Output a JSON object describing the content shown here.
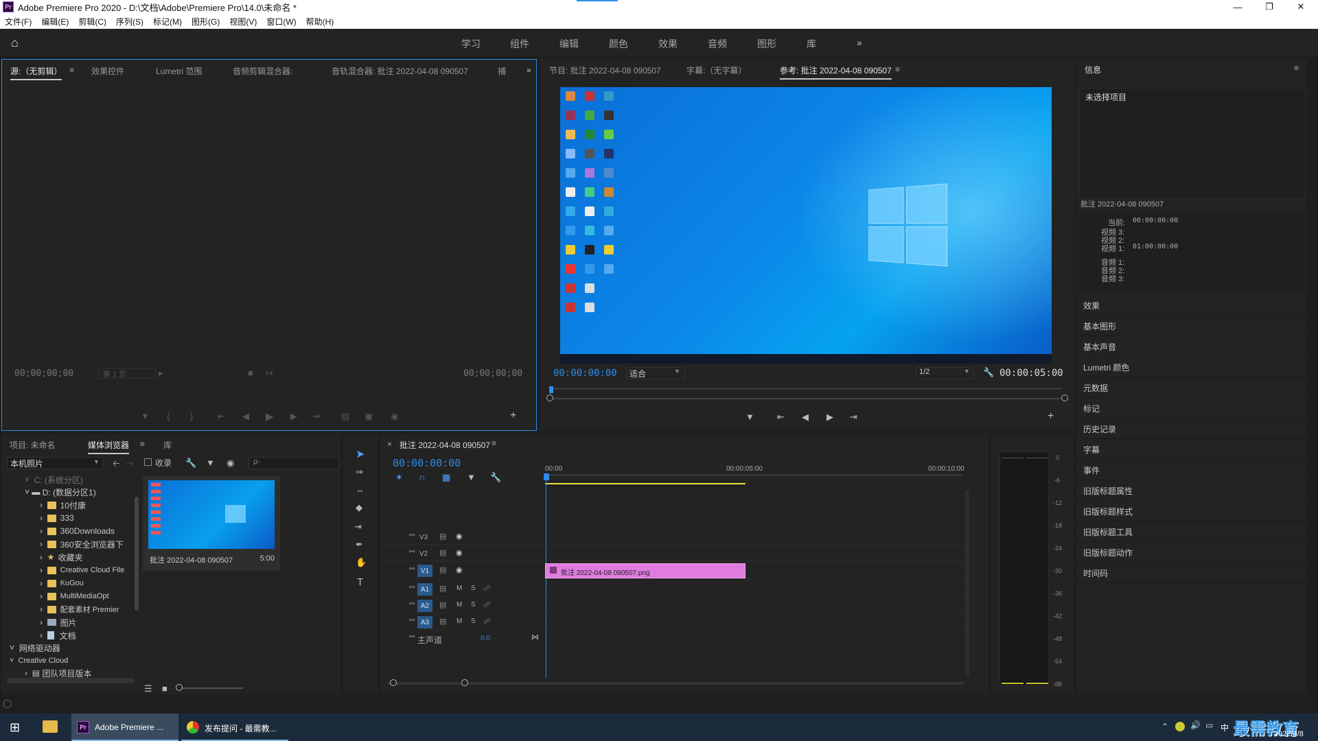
{
  "window": {
    "title": "Adobe Premiere Pro 2020 - D:\\文档\\Adobe\\Premiere Pro\\14.0\\未命名 *",
    "app_icon": "Pr"
  },
  "menu": [
    "文件(F)",
    "编辑(E)",
    "剪辑(C)",
    "序列(S)",
    "标记(M)",
    "图形(G)",
    "视图(V)",
    "窗口(W)",
    "帮助(H)"
  ],
  "workspaces": [
    "学习",
    "组件",
    "编辑",
    "颜色",
    "效果",
    "音频",
    "图形",
    "库"
  ],
  "source_panel": {
    "tabs": [
      "源:（无剪辑）",
      "效果控件",
      "Lumetri 范围",
      "音频剪辑混合器:",
      "音轨混合器: 批注 2022-04-08 090507",
      "捕"
    ],
    "tc_left": "00;00;00;00",
    "tc_right": "00;00;00;00",
    "page": "第 1 页"
  },
  "program_panel": {
    "tabs": [
      "节目: 批注 2022-04-08 090507",
      "字幕:（无字幕）",
      "参考: 批注 2022-04-08 090507"
    ],
    "tc_left": "00:00:00:00",
    "fit": "适合",
    "resolution": "1/2",
    "tc_right": "00:00:05:00"
  },
  "info_panel": {
    "title": "信息",
    "no_selection": "未选择项目",
    "clip_name": "批注 2022-04-08 090507",
    "current_label": "当前:",
    "current_value": "00:00:00:00",
    "video3": "视频 3:",
    "video2": "视频 2:",
    "video1": "视频 1:",
    "video1_value": "01:00:00:00",
    "audio1": "音频 1:",
    "audio2": "音频 2:",
    "audio3": "音频 3:"
  },
  "right_panels": [
    "效果",
    "基本图形",
    "基本声音",
    "Lumetri 颜色",
    "元数据",
    "标记",
    "历史记录",
    "字幕",
    "事件",
    "旧版标题属性",
    "旧版标题样式",
    "旧版标题工具",
    "旧版标题动作",
    "时间码"
  ],
  "project_panel": {
    "tabs": [
      "项目: 未命名",
      "媒体浏览器",
      "库"
    ],
    "location": "本机照片",
    "ingest_label": "收录",
    "search_placeholder": "ρ-",
    "tree": [
      {
        "label": "C: (系统分区)",
        "indent": 0
      },
      {
        "label": "D: (数据分区1)",
        "indent": 1
      },
      {
        "label": "10付康",
        "indent": 2
      },
      {
        "label": "333",
        "indent": 2
      },
      {
        "label": "360Downloads",
        "indent": 2
      },
      {
        "label": "360安全浏览器下",
        "indent": 2
      },
      {
        "label": "收藏夹",
        "indent": 2
      },
      {
        "label": "Creative Cloud File",
        "indent": 2
      },
      {
        "label": "KuGou",
        "indent": 2
      },
      {
        "label": "MultiMediaOpt",
        "indent": 2
      },
      {
        "label": "配套素材 Premier",
        "indent": 2
      },
      {
        "label": "图片",
        "indent": 2
      },
      {
        "label": "文档",
        "indent": 2
      },
      {
        "label": "网络驱动器",
        "indent": 0
      },
      {
        "label": "Creative Cloud",
        "indent": 0
      },
      {
        "label": "团队项目版本",
        "indent": 1
      }
    ],
    "thumb_name": "批注 2022-04-08 090507",
    "thumb_duration": "5:00"
  },
  "timeline": {
    "tab": "批注 2022-04-08 090507",
    "tc": "00:00:00:00",
    "ruler": [
      "00:00",
      "00:00:05:00",
      "00:00:10:00"
    ],
    "video_tracks": [
      "V3",
      "V2",
      "V1"
    ],
    "audio_tracks": [
      "A1",
      "A2",
      "A3"
    ],
    "master": "主声道",
    "master_value": "0.0",
    "M": "M",
    "S": "S",
    "clip": "批注 2022-04-08 090507.png"
  },
  "meter": {
    "labels": [
      "0",
      "-6",
      "-12",
      "-18",
      "-24",
      "-30",
      "-36",
      "-42",
      "-48",
      "-54",
      "dB"
    ]
  },
  "taskbar": {
    "premiere": "Adobe Premiere ...",
    "chrome": "发布提问 - 最需教...",
    "date": "2022/4/8",
    "ime": "中",
    "watermark": "最需教育"
  },
  "colors": {
    "accent": "#2d8ceb",
    "clip": "#e07be0",
    "panel": "#232323",
    "bg": "#1e1e1e"
  }
}
